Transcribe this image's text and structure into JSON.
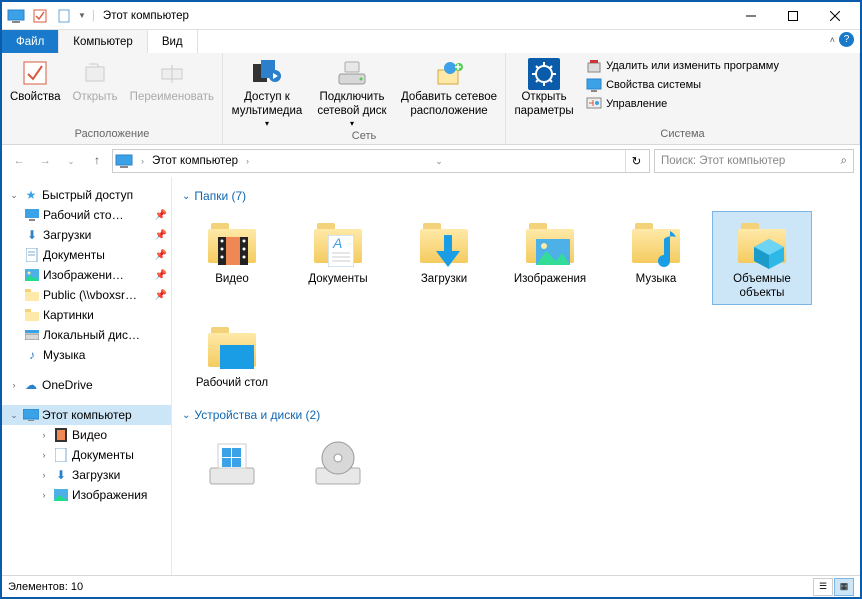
{
  "title": "Этот компьютер",
  "tabs": {
    "file": "Файл",
    "computer": "Компьютер",
    "view": "Вид"
  },
  "ribbon": {
    "groups": {
      "location": {
        "label": "Расположение",
        "properties": "Свойства",
        "open": "Открыть",
        "rename": "Переименовать"
      },
      "network": {
        "label": "Сеть",
        "media": "Доступ к\nмультимедиа",
        "mapdrive": "Подключить\nсетевой диск",
        "addloc": "Добавить сетевое\nрасположение"
      },
      "system": {
        "label": "Система",
        "params": "Открыть\nпараметры",
        "uninstall": "Удалить или изменить программу",
        "sysprops": "Свойства системы",
        "manage": "Управление"
      }
    }
  },
  "nav": {
    "location": "Этот компьютер",
    "search_placeholder": "Поиск: Этот компьютер"
  },
  "sidebar": {
    "quick": "Быстрый доступ",
    "quick_items": [
      "Рабочий сто…",
      "Загрузки",
      "Документы",
      "Изображени…",
      "Public (\\\\vboxsr…",
      "Картинки",
      "Локальный дис…",
      "Музыка"
    ],
    "onedrive": "OneDrive",
    "thispc": "Этот компьютер",
    "thispc_items": [
      "Видео",
      "Документы",
      "Загрузки",
      "Изображения"
    ]
  },
  "content": {
    "folders_header": "Папки (7)",
    "folders": [
      "Видео",
      "Документы",
      "Загрузки",
      "Изображения",
      "Музыка",
      "Объемные объекты",
      "Рабочий стол"
    ],
    "drives_header": "Устройства и диски (2)"
  },
  "status": {
    "text": "Элементов: 10"
  }
}
